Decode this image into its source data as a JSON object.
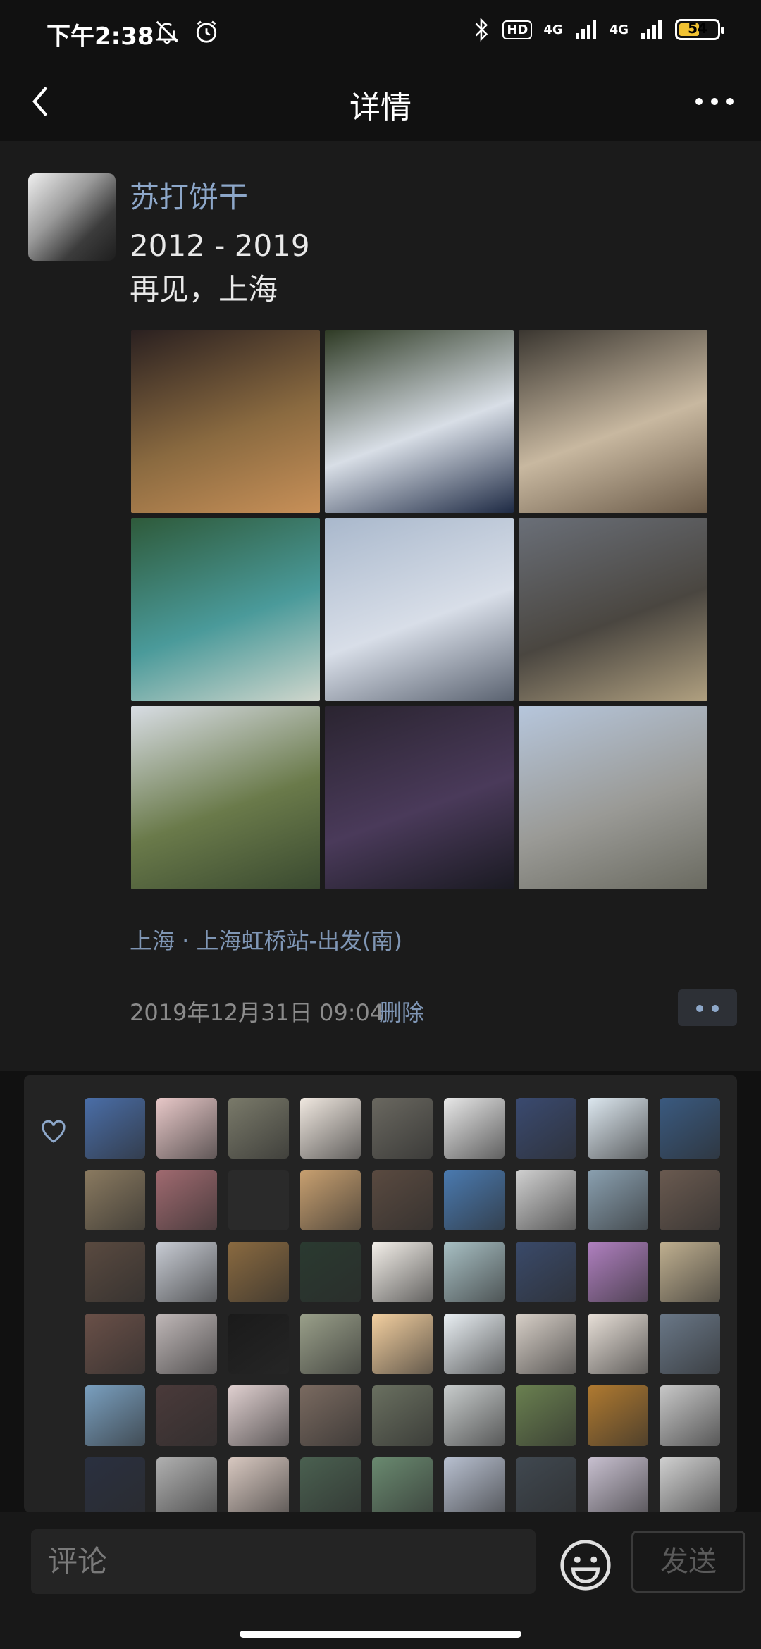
{
  "status_bar": {
    "time": "下午2:38",
    "hd": "HD",
    "net1": "4G",
    "net2": "4G",
    "battery": "54",
    "battery_level": 0.54
  },
  "nav": {
    "title": "详情"
  },
  "post": {
    "username": "苏打饼干",
    "text": "2012 - 2019\n再见，上海",
    "photos": [
      {
        "colors": [
          "#2a2020",
          "#8a6a40",
          "#c89058"
        ]
      },
      {
        "colors": [
          "#2e3a24",
          "#d8dee6",
          "#1e2a44"
        ]
      },
      {
        "colors": [
          "#3a3630",
          "#c8b8a0",
          "#6a5a48"
        ]
      },
      {
        "colors": [
          "#2e5a3a",
          "#4a9a9a",
          "#cfd6cc"
        ]
      },
      {
        "colors": [
          "#a9b8cc",
          "#d8dee8",
          "#5a6270"
        ]
      },
      {
        "colors": [
          "#6a6f78",
          "#4a4640",
          "#b0a080"
        ]
      },
      {
        "colors": [
          "#d8dde4",
          "#6a7a4a",
          "#3a4a30"
        ]
      },
      {
        "colors": [
          "#2a2430",
          "#4a3a5a",
          "#1a1a22"
        ]
      },
      {
        "colors": [
          "#b6c6dc",
          "#9a9a96",
          "#6a6a60"
        ]
      }
    ],
    "location": "上海 · 上海虹桥站-出发(南)",
    "time": "2019年12月31日 09:04",
    "delete_label": "删除"
  },
  "likes": {
    "avatars": [
      "#4a6ea8",
      "#e8c8c8",
      "#7a7a6a",
      "#f0e8e0",
      "#6a6860",
      "#e8e8e8",
      "#3a4a70",
      "#dde8f0",
      "#3a5a80",
      "#8a7a60",
      "#a06a70",
      "#2a2a2a",
      "#c8a070",
      "#5a4a40",
      "#4a7ab0",
      "#d0d0d0",
      "#8aa0b0",
      "#6a5a50",
      "#5a4a40",
      "#c8ccd4",
      "#8a6a40",
      "#2a3a30",
      "#f4f0ea",
      "#a8c0c4",
      "#3a4a6a",
      "#b080c0",
      "#c0b090",
      "#6a5048",
      "#c0b8b8",
      "#1a1a1a",
      "#9aa08a",
      "#f4d0a0",
      "#eaf0f4",
      "#d8d0c8",
      "#e8e0d8",
      "#6a7888",
      "#7aa0c0",
      "#4a3a3a",
      "#e0d0d0",
      "#7a6a60",
      "#6a7060",
      "#c8cccc",
      "#6a8050",
      "#b07a30",
      "#c8c8c8",
      "#2a3040",
      "#b0b0b0",
      "#d8c8c0",
      "#4a6050",
      "#6a8a70",
      "#b8c0d0",
      "#404850",
      "#c8c0d0",
      "#d0d0d0"
    ]
  },
  "comment": {
    "placeholder": "评论",
    "send_label": "发送"
  },
  "colors": {
    "accent_link": "#8da7c9",
    "background": "#111111",
    "post_bg": "#1b1b1b",
    "likes_bg": "#232323"
  }
}
